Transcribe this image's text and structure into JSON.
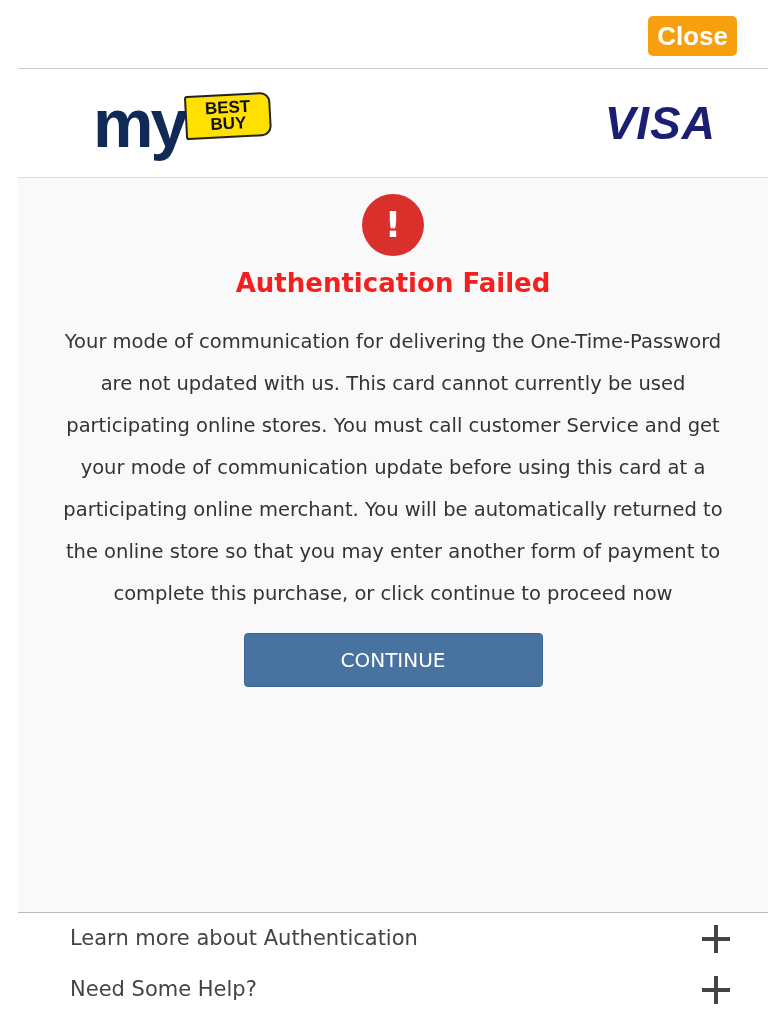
{
  "close_button": "Close",
  "header": {
    "merchant_logo": {
      "prefix": "my",
      "tag": "BEST BUY"
    },
    "network_logo": "VISA"
  },
  "alert": {
    "icon": "!",
    "title": "Authentication Failed",
    "message": "Your mode of communication for delivering the One-Time-Password are not updated with us. This card cannot currently be used participating online stores. You must call customer Service and get your mode of communication update before using this card at a participating online merchant. You will be automatically returned to the online store so that you may enter another form of payment to complete this purchase, or click continue to proceed now",
    "button": "CONTINUE"
  },
  "accordion": [
    {
      "label": "Learn more about Authentication",
      "expanded": false
    },
    {
      "label": "Need Some Help?",
      "expanded": false
    }
  ]
}
